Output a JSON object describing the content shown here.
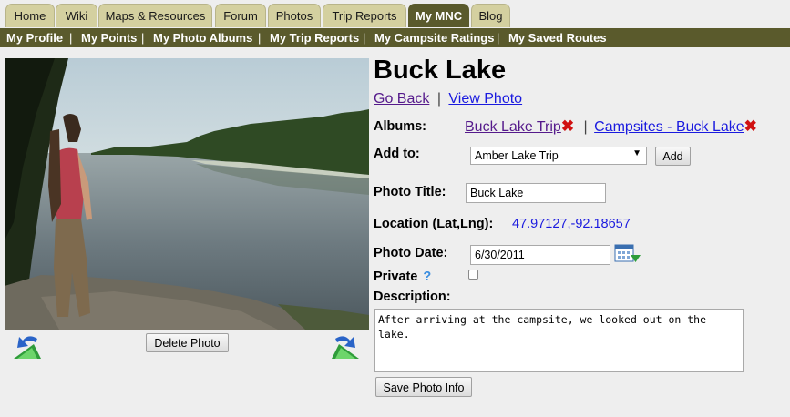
{
  "nav": {
    "tabs": [
      {
        "label": "Home"
      },
      {
        "label": "Wiki"
      },
      {
        "label": "Maps & Resources"
      },
      {
        "label": "Forum"
      },
      {
        "label": "Photos"
      },
      {
        "label": "Trip Reports"
      },
      {
        "label": "My MNC",
        "active": true
      },
      {
        "label": "Blog"
      }
    ],
    "subnav": [
      {
        "label": "My Profile"
      },
      {
        "label": "My Points"
      },
      {
        "label": "My Photo Albums"
      },
      {
        "label": "My Trip Reports"
      },
      {
        "label": "My Campsite Ratings"
      },
      {
        "label": "My Saved Routes"
      }
    ],
    "separator": "|"
  },
  "photo": {
    "delete_label": "Delete Photo",
    "prev_icon": "rotate-left-icon",
    "next_icon": "rotate-right-icon"
  },
  "details": {
    "title": "Buck Lake",
    "go_back": "Go Back",
    "view_photo": "View Photo",
    "link_separator": "|",
    "albums_label": "Albums:",
    "albums": [
      {
        "name": "Buck Lake Trip"
      },
      {
        "name": "Campsites - Buck Lake"
      }
    ],
    "remove_mark": "✖",
    "add_to_label": "Add to:",
    "add_to_selected": "Amber Lake Trip",
    "add_button": "Add",
    "photo_title_label": "Photo Title:",
    "photo_title_value": "Buck Lake",
    "location_label": "Location (Lat,Lng):",
    "location_value": "47.97127,-92.18657",
    "photo_date_label": "Photo Date:",
    "photo_date_value": "6/30/2011",
    "private_label": "Private",
    "private_help": "?",
    "private_checked": false,
    "description_label": "Description:",
    "description_value": "After arriving at the campsite, we looked out on the lake.",
    "save_button": "Save Photo Info"
  },
  "colors": {
    "tab_bg": "#d4d0a0",
    "tab_active_bg": "#5a5a2c",
    "subnav_bg": "#5a5a2c",
    "remove_mark": "#d01010",
    "link_visited": "#551a8b",
    "link": "#1a1adf"
  }
}
